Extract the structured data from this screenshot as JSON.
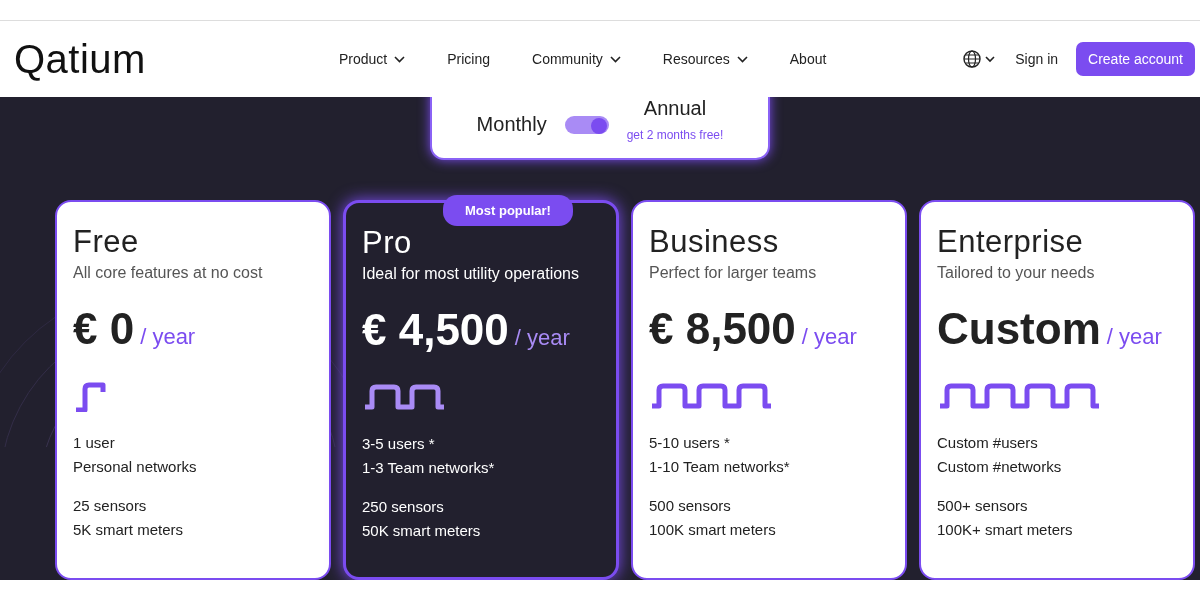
{
  "nav": {
    "logo": "Qatium",
    "items": [
      {
        "label": "Product",
        "dropdown": true
      },
      {
        "label": "Pricing",
        "dropdown": false
      },
      {
        "label": "Community",
        "dropdown": true
      },
      {
        "label": "Resources",
        "dropdown": true
      },
      {
        "label": "About",
        "dropdown": false
      }
    ],
    "sign_in": "Sign in",
    "create_account": "Create account"
  },
  "billing": {
    "monthly": "Monthly",
    "annual": "Annual",
    "annual_note": "get 2 months free!",
    "on": true
  },
  "plans": [
    {
      "name": "Free",
      "tagline": "All core features at no cost",
      "price": "€ 0",
      "period": "/ year",
      "highlighted": false,
      "features": [
        "1 user",
        "Personal networks"
      ],
      "limits": [
        "25 sensors",
        "5K smart meters"
      ]
    },
    {
      "name": "Pro",
      "tagline": "Ideal for most utility operations",
      "price": "€ 4,500",
      "period": "/ year",
      "highlighted": true,
      "badge": "Most popular!",
      "features": [
        "3-5 users *",
        "1-3 Team networks*"
      ],
      "limits": [
        "250 sensors",
        "50K smart meters"
      ]
    },
    {
      "name": "Business",
      "tagline": "Perfect for larger teams",
      "price": "€ 8,500",
      "period": "/ year",
      "highlighted": false,
      "features": [
        "5-10 users *",
        "1-10 Team networks*"
      ],
      "limits": [
        "500 sensors",
        "100K smart meters"
      ]
    },
    {
      "name": "Enterprise",
      "tagline": "Tailored to your needs",
      "price": "Custom",
      "period": "/ year",
      "highlighted": false,
      "features": [
        "Custom #users",
        "Custom #networks"
      ],
      "limits": [
        "500+ sensors",
        "100K+ smart meters"
      ]
    }
  ]
}
